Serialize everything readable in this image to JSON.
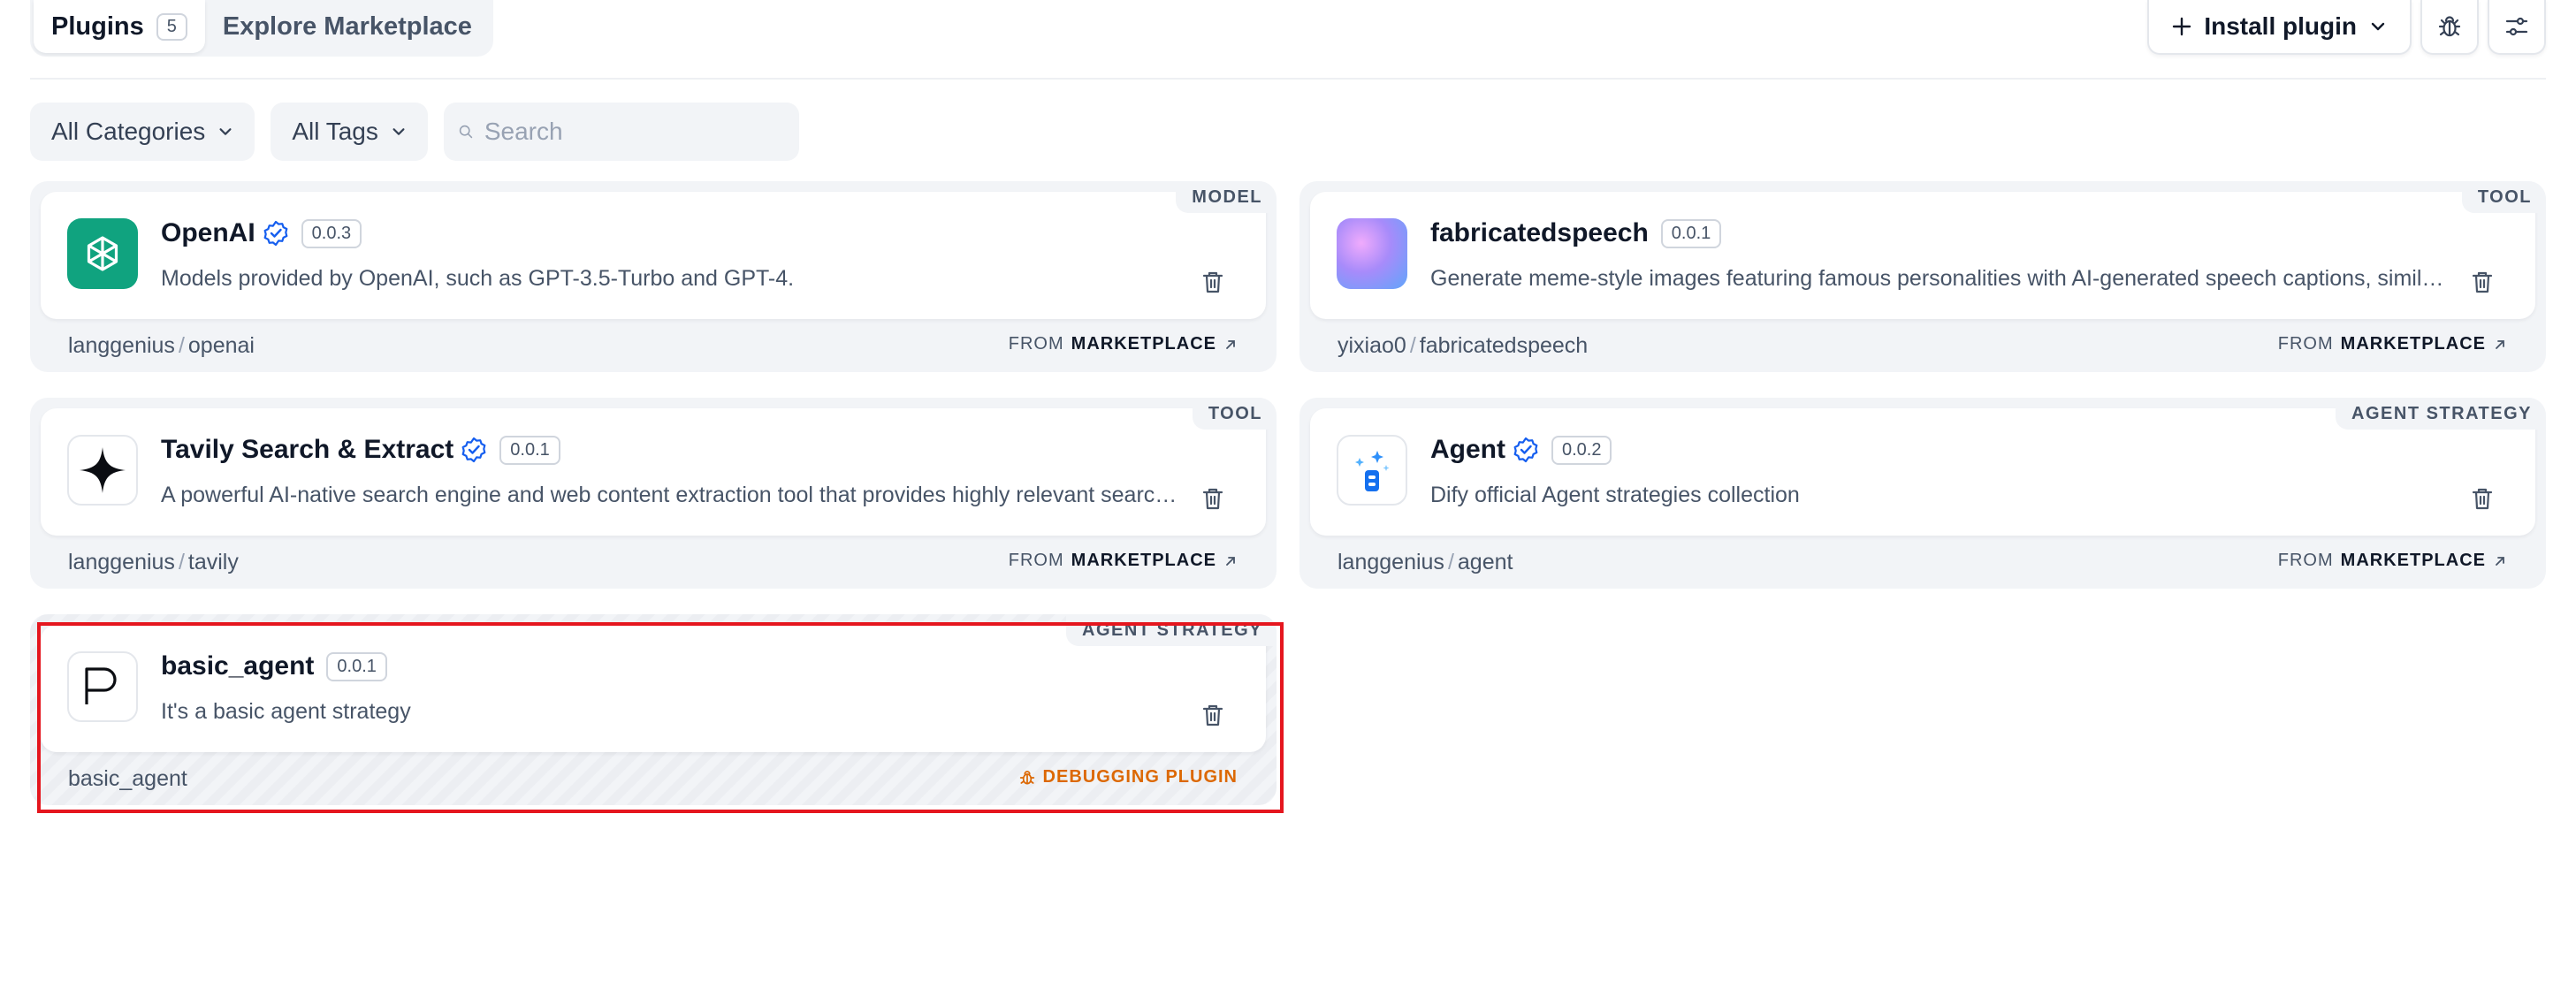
{
  "tabs": [
    {
      "label": "Plugins",
      "count": "5"
    },
    {
      "label": "Explore Marketplace"
    }
  ],
  "actions": {
    "install_label": "Install plugin"
  },
  "filters": {
    "categories": "All Categories",
    "tags": "All Tags",
    "search_placeholder": "Search"
  },
  "plugins": [
    {
      "name": "OpenAI",
      "version": "0.0.3",
      "category": "MODEL",
      "verified": true,
      "description": "Models provided by OpenAI, such as GPT-3.5-Turbo and GPT-4.",
      "author": "langgenius",
      "slug": "openai",
      "source_prefix": "FROM",
      "source": "MARKETPLACE",
      "logo": "openai-logo"
    },
    {
      "name": "fabricatedspeech",
      "version": "0.0.1",
      "category": "TOOL",
      "verified": false,
      "description": "Generate meme-style images featuring famous personalities with AI-generated speech captions, similar to fabricated quotes.",
      "author": "yixiao0",
      "slug": "fabricatedspeech",
      "source_prefix": "FROM",
      "source": "MARKETPLACE",
      "logo": "gradient-logo"
    },
    {
      "name": "Tavily Search & Extract",
      "version": "0.0.1",
      "category": "TOOL",
      "verified": true,
      "description": "A powerful AI-native search engine and web content extraction tool that provides highly relevant search results.",
      "author": "langgenius",
      "slug": "tavily",
      "source_prefix": "FROM",
      "source": "MARKETPLACE",
      "logo": "tavily-logo"
    },
    {
      "name": "Agent",
      "version": "0.0.2",
      "category": "AGENT STRATEGY",
      "verified": true,
      "description": "Dify official Agent strategies collection",
      "author": "langgenius",
      "slug": "agent",
      "source_prefix": "FROM",
      "source": "MARKETPLACE",
      "logo": "agent-logo"
    },
    {
      "name": "basic_agent",
      "version": "0.0.1",
      "category": "AGENT STRATEGY",
      "verified": false,
      "description": "It's a basic agent strategy",
      "author": "basic_agent",
      "source": "DEBUGGING PLUGIN",
      "logo": "p-logo"
    }
  ],
  "colors": {
    "accent": "#155eef",
    "debug": "#dc6803",
    "highlight": "#e5161e",
    "openai_green": "#10a37f"
  }
}
